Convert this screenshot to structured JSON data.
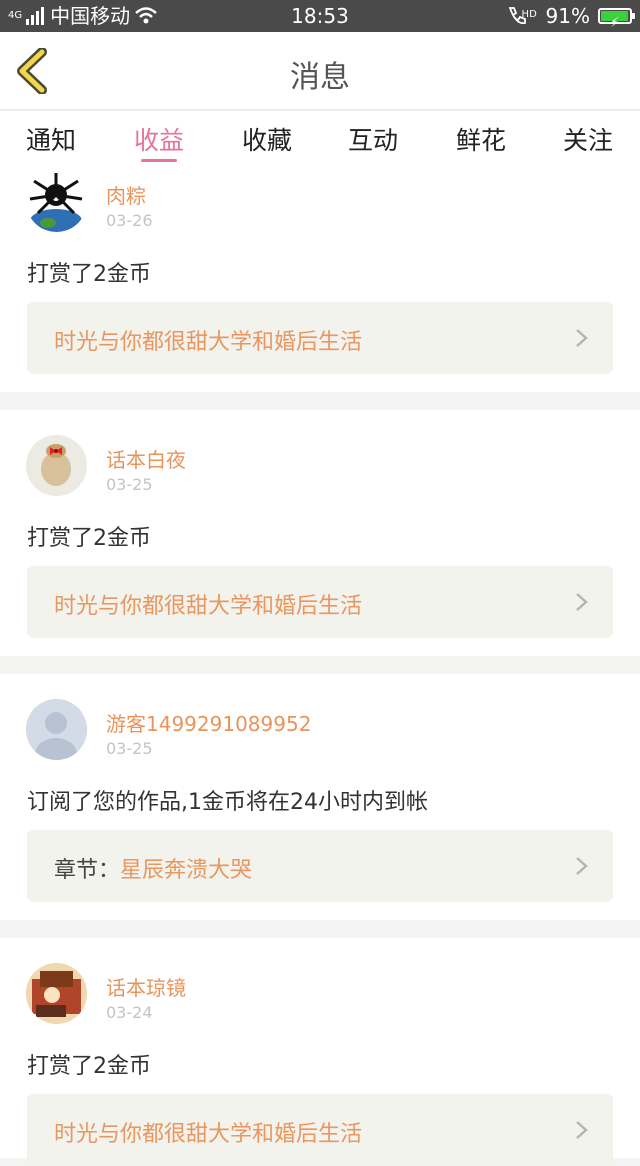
{
  "status": {
    "carrier": "中国移动",
    "network": "4G",
    "time": "18:53",
    "hd": "HD",
    "battery": "91%",
    "battery_level": 0.91,
    "battery_color": "#3ad13a"
  },
  "nav": {
    "title": "消息"
  },
  "tabs": [
    {
      "label": "通知"
    },
    {
      "label": "收益",
      "active": true
    },
    {
      "label": "收藏"
    },
    {
      "label": "互动"
    },
    {
      "label": "鲜花"
    },
    {
      "label": "关注"
    }
  ],
  "accent": "#e5739a",
  "items": [
    {
      "user": "肉粽",
      "date": "03-26",
      "action": "打赏了2金币",
      "work_prefix": "",
      "work": "时光与你都很甜大学和婚后生活"
    },
    {
      "user": "话本白夜",
      "date": "03-25",
      "action": "打赏了2金币",
      "work_prefix": "",
      "work": "时光与你都很甜大学和婚后生活"
    },
    {
      "user": "游客1499291089952",
      "date": "03-25",
      "action": "订阅了您的作品,1金币将在24小时内到帐",
      "work_prefix": "章节：",
      "work": "星辰奔溃大哭"
    },
    {
      "user": "话本琼镜",
      "date": "03-24",
      "action": "打赏了2金币",
      "work_prefix": "",
      "work": "时光与你都很甜大学和婚后生活"
    }
  ]
}
